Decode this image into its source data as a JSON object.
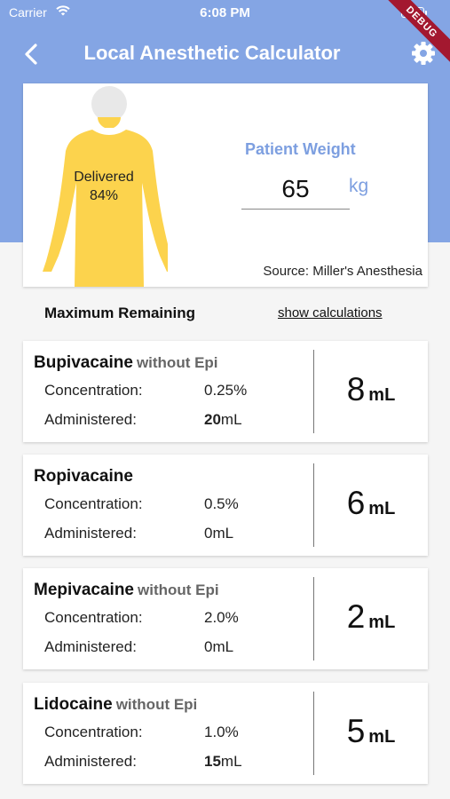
{
  "status_bar": {
    "carrier": "Carrier",
    "time": "6:08 PM"
  },
  "debug_badge": "DEBUG",
  "nav": {
    "title": "Local Anesthetic Calculator"
  },
  "patient": {
    "delivered_label": "Delivered",
    "delivered_percent": "84%",
    "weight_label": "Patient Weight",
    "weight_value": "65",
    "weight_unit": "kg",
    "source": "Source: Miller's Anesthesia"
  },
  "section": {
    "max_remaining_label": "Maximum Remaining",
    "show_calculations": "show calculations"
  },
  "labels": {
    "concentration": "Concentration:",
    "administered": "Administered:"
  },
  "drugs": [
    {
      "name": "Bupivacaine",
      "qualifier": "without Epi",
      "concentration": "0.25%",
      "administered_amount": "20",
      "administered_unit": "mL",
      "remaining": "8",
      "remaining_unit": "mL"
    },
    {
      "name": "Ropivacaine",
      "qualifier": "",
      "concentration": "0.5%",
      "administered_amount": "0mL",
      "administered_unit": "",
      "remaining": "6",
      "remaining_unit": "mL"
    },
    {
      "name": "Mepivacaine",
      "qualifier": "without Epi",
      "concentration": "2.0%",
      "administered_amount": "0mL",
      "administered_unit": "",
      "remaining": "2",
      "remaining_unit": "mL"
    },
    {
      "name": "Lidocaine",
      "qualifier": "without Epi",
      "concentration": "1.0%",
      "administered_amount": "15",
      "administered_unit": "mL",
      "remaining": "5",
      "remaining_unit": "mL"
    }
  ],
  "colors": {
    "header": "#84a5e4",
    "accent": "#7d9fe0",
    "body_fill": "#fcd34d",
    "head_fill": "#e8e8e8",
    "debug": "#a3182f"
  },
  "icons": {
    "back": "chevron-left-icon",
    "settings": "gear-icon",
    "wifi": "wifi-icon",
    "battery": "battery-icon"
  }
}
